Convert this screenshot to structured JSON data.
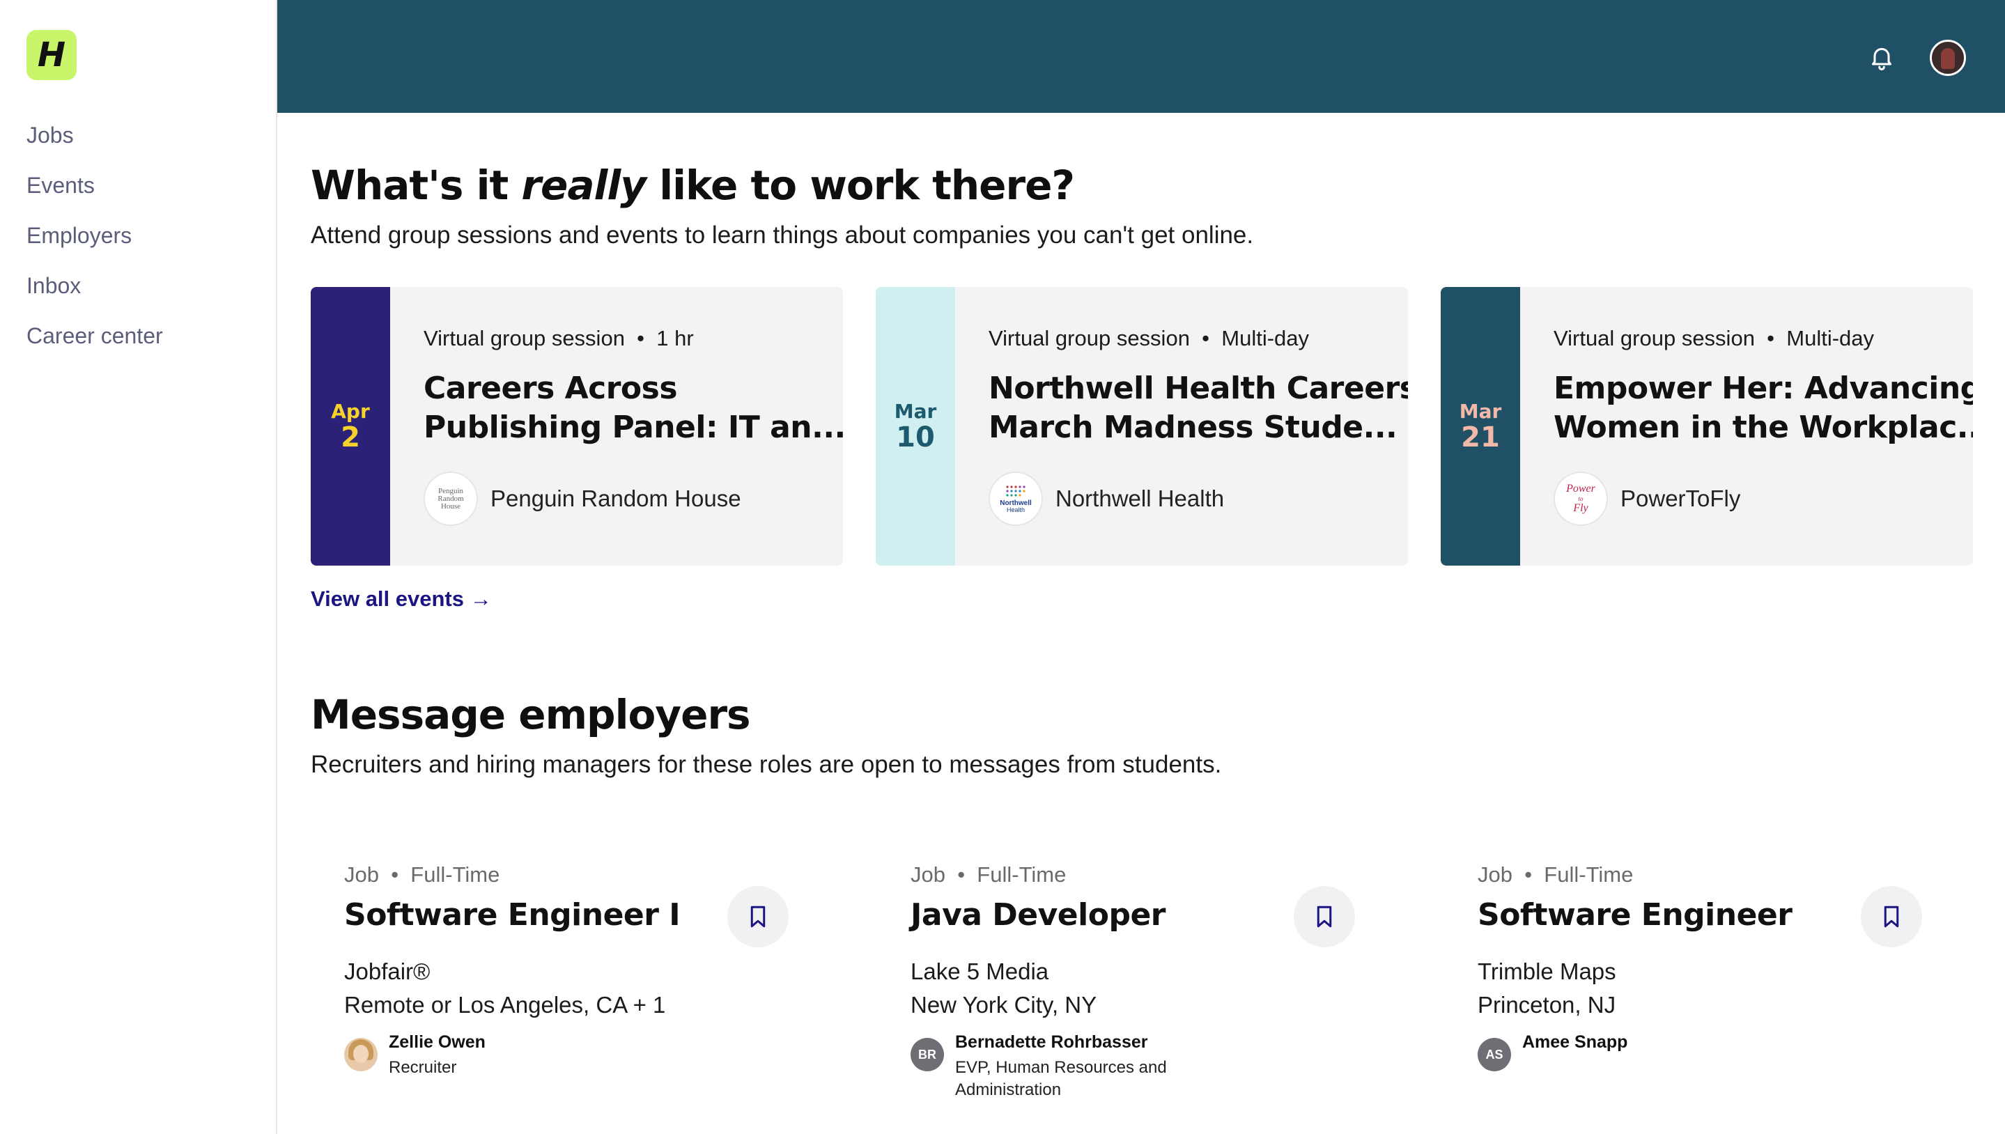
{
  "nav": {
    "logo_letter": "H",
    "items": [
      "Jobs",
      "Events",
      "Employers",
      "Inbox",
      "Career center"
    ]
  },
  "events_section": {
    "title_before": "What's it ",
    "title_emphasis": "really",
    "title_after": " like to work there?",
    "subtitle": "Attend group sessions and events to learn things about companies you can't get online.",
    "cards": [
      {
        "month": "Apr",
        "day": "2",
        "strip_color": "#2b2177",
        "date_color": "#f6d22a",
        "type": "Virtual group session",
        "duration": "1 hr",
        "title_line1": "Careers Across",
        "title_line2": "Publishing Panel: IT an...",
        "org": "Penguin Random House",
        "org_logo_text": [
          "Penguin",
          "Random",
          "House"
        ]
      },
      {
        "month": "Mar",
        "day": "10",
        "strip_color": "#cfeff0",
        "date_color": "#1d5a6e",
        "type": "Virtual group session",
        "duration": "Multi-day",
        "title_line1": "Northwell Health Careers",
        "title_line2": "March Madness Stude...",
        "org": "Northwell Health",
        "org_logo_text": [
          "Northwell",
          "Health"
        ]
      },
      {
        "month": "Mar",
        "day": "21",
        "strip_color": "#1f5066",
        "date_color": "#f2b9a8",
        "type": "Virtual group session",
        "duration": "Multi-day",
        "title_line1": "Empower Her: Advancing",
        "title_line2": "Women in the Workplac...",
        "org": "PowerToFly",
        "org_logo_text": [
          "Power",
          "to",
          "Fly"
        ]
      }
    ],
    "view_all": "View all events →"
  },
  "messages_section": {
    "title": "Message employers",
    "subtitle": "Recruiters and hiring managers for these roles are open to messages from students.",
    "jobs": [
      {
        "kind": "Job",
        "type": "Full-Time",
        "title": "Software Engineer I",
        "company": "Jobfair®",
        "location": "Remote or Los Angeles, CA + 1",
        "contact_name": "Zellie Owen",
        "contact_role_1": "Recruiter",
        "contact_role_2": "",
        "contact_initials": ""
      },
      {
        "kind": "Job",
        "type": "Full-Time",
        "title": "Java Developer",
        "company": "Lake 5 Media",
        "location": "New York City, NY",
        "contact_name": "Bernadette Rohrbasser",
        "contact_role_1": "EVP, Human Resources and",
        "contact_role_2": "Administration",
        "contact_initials": "BR"
      },
      {
        "kind": "Job",
        "type": "Full-Time",
        "title": "Software Engineer",
        "company": "Trimble Maps",
        "location": "Princeton, NJ",
        "contact_name": "Amee Snapp",
        "contact_role_1": "",
        "contact_role_2": "",
        "contact_initials": "AS"
      }
    ]
  },
  "colors": {
    "topbar": "#1f5066",
    "logo_bg": "#c9f56a",
    "link": "#1a1582"
  },
  "icons": {
    "notifications": "bell-icon",
    "save": "bookmark-icon",
    "profile": "user-avatar"
  }
}
